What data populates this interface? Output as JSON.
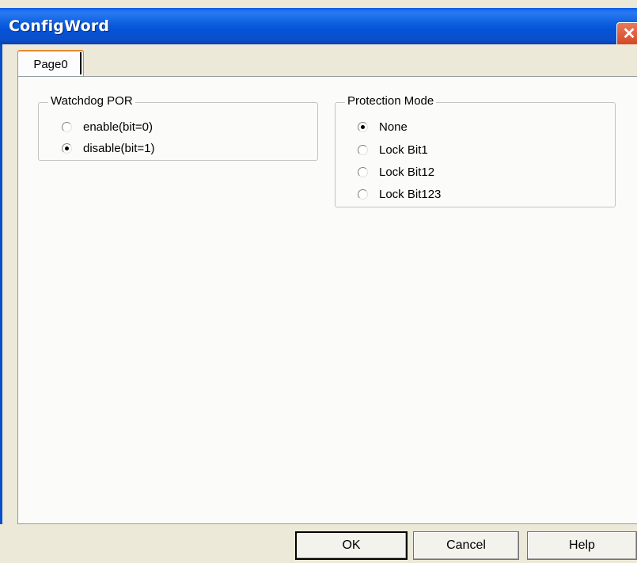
{
  "window": {
    "title": "ConfigWord",
    "close_symbol": "✕"
  },
  "tabs": [
    {
      "label": "Page0",
      "selected": true
    }
  ],
  "watchdog": {
    "title": "Watchdog POR",
    "options": [
      {
        "label": "enable(bit=0)",
        "checked": false
      },
      {
        "label": "disable(bit=1)",
        "checked": true
      }
    ]
  },
  "protection": {
    "title": "Protection Mode",
    "options": [
      {
        "label": "None",
        "checked": true
      },
      {
        "label": "Lock Bit1",
        "checked": false
      },
      {
        "label": "Lock Bit12",
        "checked": false
      },
      {
        "label": "Lock Bit123",
        "checked": false
      }
    ]
  },
  "buttons": {
    "ok": "OK",
    "cancel": "Cancel",
    "help": "Help"
  }
}
